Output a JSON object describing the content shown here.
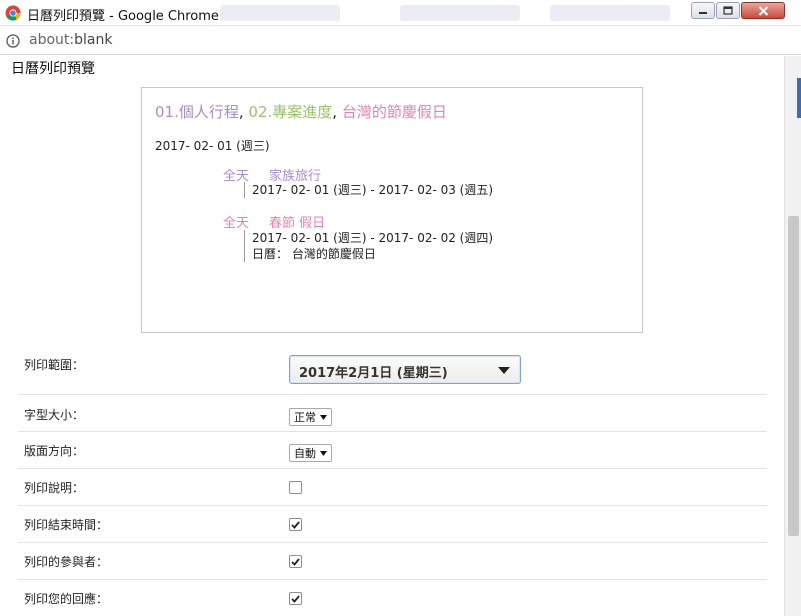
{
  "window": {
    "title": "日曆列印預覽 - Google Chrome",
    "background_tabs": [
      "",
      "",
      ""
    ]
  },
  "address": {
    "scheme": "about:",
    "path": "blank"
  },
  "page": {
    "title": "日曆列印預覽"
  },
  "preview": {
    "calendars": [
      {
        "label": "01.個人行程",
        "color": "#a38fd0"
      },
      {
        "label": "02.專案進度",
        "color": "#9ac36a"
      },
      {
        "label": "台灣的節慶假日",
        "color": "#df86b0"
      }
    ],
    "separator": ", ",
    "date": "2017- 02- 01 (週三)",
    "events": [
      {
        "time": "全天",
        "title": "家族旅行",
        "color": "#a38fd0",
        "details": [
          "2017- 02- 01 (週三) -  2017- 02- 03 (週五)"
        ]
      },
      {
        "time": "全天",
        "title": "春節 假日",
        "color": "#df86b0",
        "details": [
          "2017- 02- 01 (週三) -  2017- 02- 02 (週四)",
          "日曆： 台灣的節慶假日"
        ]
      }
    ]
  },
  "settings": {
    "print_range": {
      "label": "列印範圍：",
      "value": "2017年2月1日 (星期三)"
    },
    "font_size": {
      "label": "字型大小：",
      "value": "正常"
    },
    "orientation": {
      "label": "版面方向：",
      "value": "自動"
    },
    "print_description": {
      "label": "列印說明：",
      "checked": false
    },
    "print_end_time": {
      "label": "列印結束時間：",
      "checked": true
    },
    "print_attendees": {
      "label": "列印的參與者：",
      "checked": true
    },
    "print_responses": {
      "label": "列印您的回應：",
      "checked": true
    }
  },
  "icons": {
    "app": "chrome-logo-icon",
    "address": "info-icon",
    "dropdown": "triangle-down-icon",
    "check": "checkmark-icon"
  }
}
